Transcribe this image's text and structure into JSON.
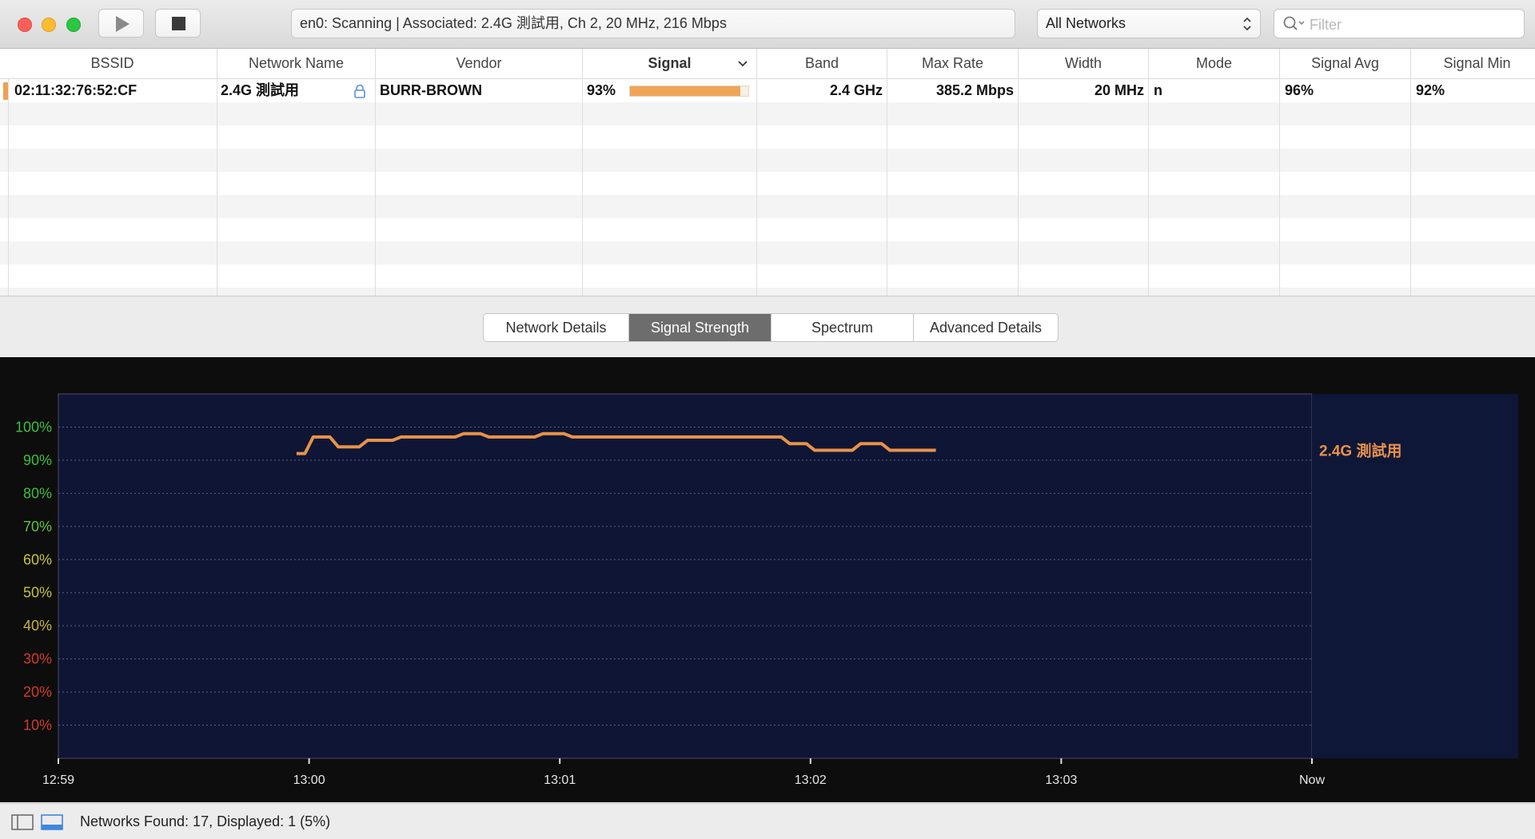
{
  "toolbar": {
    "status": "en0: Scanning  |  Associated: 2.4G 測試用, Ch 2, 20 MHz, 216 Mbps",
    "network_filter": "All Networks",
    "filter_placeholder": "Filter",
    "icons": [
      "play-icon",
      "stop-icon",
      "search-icon",
      "up-down-chevron-icon"
    ]
  },
  "table": {
    "columns": [
      "BSSID",
      "Network Name",
      "Vendor",
      "Signal",
      "Band",
      "Max Rate",
      "Width",
      "Mode",
      "Signal Avg",
      "Signal Min"
    ],
    "sorted_column": "Signal",
    "rows": [
      {
        "bssid": "02:11:32:76:52:CF",
        "network_name": "2.4G 測試用",
        "secured": true,
        "vendor": "BURR-BROWN",
        "signal": "93%",
        "signal_fraction": 0.93,
        "signal_color": "#f0a458",
        "band": "2.4 GHz",
        "max_rate": "385.2 Mbps",
        "width": "20 MHz",
        "mode": "n",
        "signal_avg": "96%",
        "signal_min": "92%"
      }
    ]
  },
  "tabs": [
    {
      "label": "Network Details",
      "active": false
    },
    {
      "label": "Signal Strength",
      "active": true
    },
    {
      "label": "Spectrum",
      "active": false
    },
    {
      "label": "Advanced Details",
      "active": false
    }
  ],
  "chart_data": {
    "type": "line",
    "xlabel": "",
    "ylabel": "",
    "yticks": [
      "100%",
      "90%",
      "80%",
      "70%",
      "60%",
      "50%",
      "40%",
      "30%",
      "20%",
      "10%"
    ],
    "ytick_values": [
      100,
      90,
      80,
      70,
      60,
      50,
      40,
      30,
      20,
      10
    ],
    "ytick_colors": [
      "#3bbf3b",
      "#3bbf3b",
      "#3bbf3b",
      "#66c23a",
      "#c8c43a",
      "#c8c43a",
      "#c8b43a",
      "#d23a2a",
      "#d23a2a",
      "#d23a2a"
    ],
    "xticks": [
      "12:59",
      "13:00",
      "13:01",
      "13:02",
      "13:03",
      "Now"
    ],
    "ylim": [
      0,
      110
    ],
    "grid": true,
    "background": "#0e1535",
    "series": [
      {
        "name": "2.4G 測試用",
        "color": "#e8924a",
        "x": [
          "12:59:57",
          "12:59:59",
          "13:00:01",
          "13:00:05",
          "13:00:07",
          "13:00:12",
          "13:00:14",
          "13:00:20",
          "13:00:22",
          "13:00:35",
          "13:00:37",
          "13:00:41",
          "13:00:43",
          "13:00:54",
          "13:00:56",
          "13:01:01",
          "13:01:03",
          "13:01:15",
          "13:01:17",
          "13:01:53",
          "13:01:55",
          "13:01:59",
          "13:02:01",
          "13:02:10",
          "13:02:12",
          "13:02:17",
          "13:02:19",
          "13:02:24",
          "13:02:26",
          "13:02:30"
        ],
        "y": [
          92,
          92,
          97,
          97,
          94,
          94,
          96,
          96,
          97,
          97,
          98,
          98,
          97,
          97,
          98,
          98,
          97,
          97,
          97,
          97,
          95,
          95,
          93,
          93,
          95,
          95,
          93,
          93,
          93,
          93
        ]
      }
    ]
  },
  "footer": {
    "status": "Networks Found: 17, Displayed: 1 (5%)",
    "icons": [
      "sidebar-toggle-icon",
      "bottom-panel-toggle-icon"
    ]
  }
}
